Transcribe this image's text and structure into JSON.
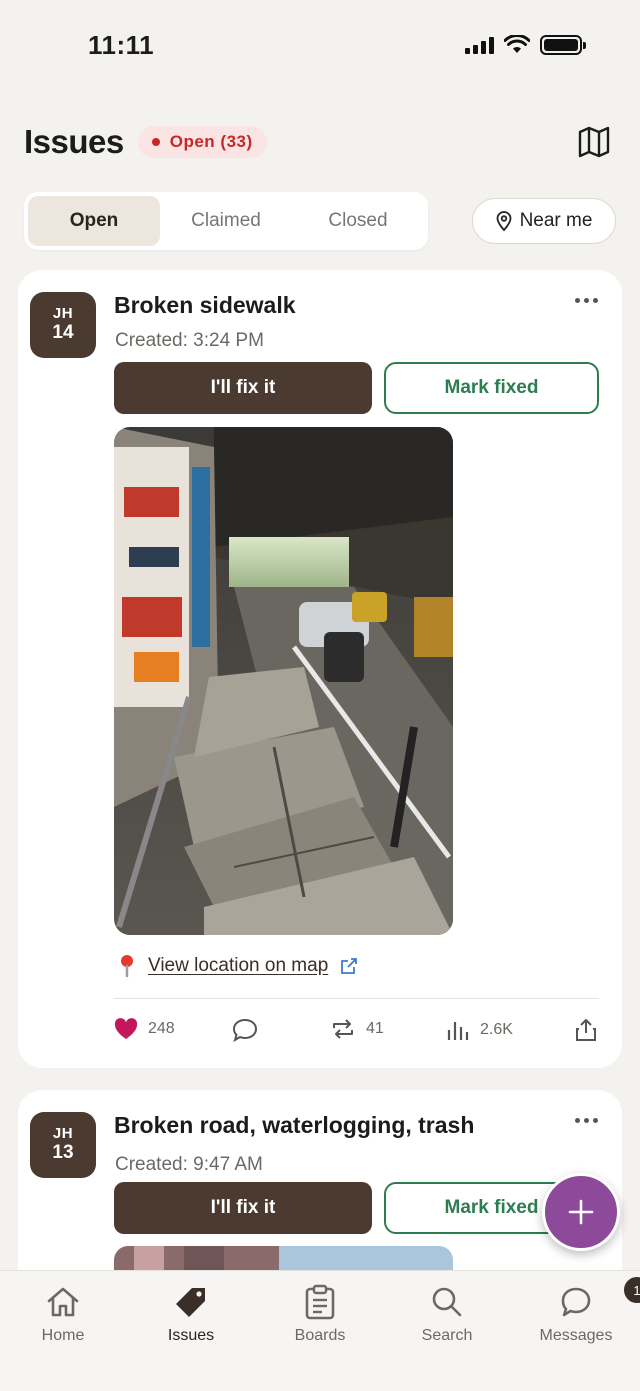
{
  "status_bar": {
    "time": "11:11"
  },
  "header": {
    "title": "Issues",
    "badge": "Open (33)"
  },
  "tabs": [
    {
      "label": "Open",
      "active": true
    },
    {
      "label": "Claimed",
      "active": false
    },
    {
      "label": "Closed",
      "active": false
    }
  ],
  "near_me": {
    "label": "Near me"
  },
  "issues": [
    {
      "avatar_initials": "JH",
      "avatar_number": "14",
      "title": "Broken sidewalk",
      "created": "Created: 3:24 PM",
      "fix_label": "I'll fix it",
      "mark_label": "Mark fixed",
      "location_link": "View location on map",
      "likes": "248",
      "reposts": "41",
      "views": "2.6K"
    },
    {
      "avatar_initials": "JH",
      "avatar_number": "13",
      "title": "Broken road, waterlogging, trash",
      "created": "Created: 9:47 AM",
      "fix_label": "I'll fix it",
      "mark_label": "Mark fixed"
    }
  ],
  "bottom_nav": [
    {
      "label": "Home",
      "icon": "home-icon"
    },
    {
      "label": "Issues",
      "icon": "tag-icon",
      "active": true
    },
    {
      "label": "Boards",
      "icon": "clipboard-icon"
    },
    {
      "label": "Search",
      "icon": "search-icon"
    },
    {
      "label": "Messages",
      "icon": "chat-icon",
      "badge": "1"
    }
  ],
  "colors": {
    "accent_dark": "#4a3a30",
    "success": "#2e7d52",
    "badge_red": "#c62828",
    "fab": "#8e4a9a",
    "like": "#c2185b"
  }
}
